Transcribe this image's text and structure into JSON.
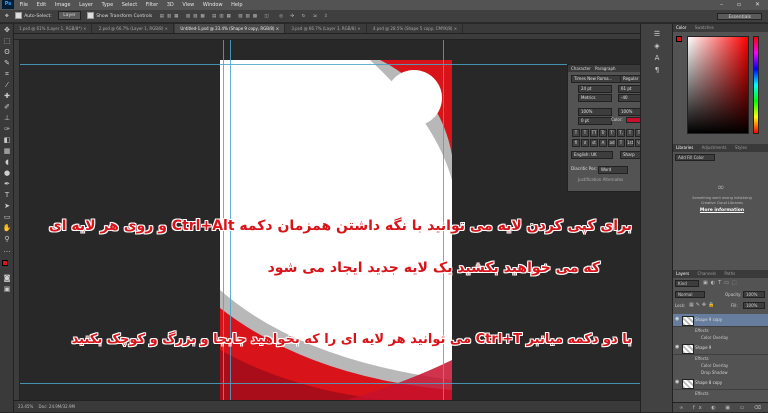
{
  "menubar": {
    "logo": "Ps",
    "items": [
      "File",
      "Edit",
      "Image",
      "Layer",
      "Type",
      "Select",
      "Filter",
      "3D",
      "View",
      "Window",
      "Help"
    ],
    "window_buttons": "– ▫ ✕"
  },
  "optionsbar": {
    "auto_select": "Auto-Select:",
    "auto_select_value": "Layer",
    "show_transform": "Show Transform Controls",
    "workspace": "Essentials"
  },
  "tabs": [
    {
      "label": "1.psd @ 61% (Layer 1, RGB/8*) ×",
      "active": false
    },
    {
      "label": "2.psd @ 66.7% (Layer 1, RGB/8) ×",
      "active": false
    },
    {
      "label": "Untitled-1.psd @ 23.4% (Shape 9 copy, RGB/8) ×",
      "active": true
    },
    {
      "label": "3.psd @ 66.7% (Layer 3, RGB/8) ×",
      "active": false
    },
    {
      "label": "4.psd @ 28.5% (Shape 5 copy, CMYK/8) ×",
      "active": false
    }
  ],
  "status": {
    "zoom": "23.45%",
    "doc": "Doc: 24.9M/32.9M"
  },
  "character": {
    "tabs": [
      "Character",
      "Paragraph"
    ],
    "font_family": "Times New Roma...",
    "font_style": "Regular",
    "size": "24 pt",
    "leading": "61 pt",
    "kerning": "Metrics",
    "tracking": "-40",
    "vscale": "100%",
    "hscale": "100%",
    "baseline": "0 pt",
    "color_label": "Color:",
    "color": "#c8102e",
    "styles": [
      "T",
      "T",
      "TT",
      "Tr",
      "T'",
      "T,",
      "T",
      "T"
    ],
    "features": [
      "fi",
      "σ",
      "st",
      "A",
      "ad",
      "T",
      "1st",
      "½"
    ],
    "language": "English: UK",
    "aa": "Sharp",
    "diacritic_label": "Diacritic Pos:",
    "diacritic": "Word",
    "justification": "Justification Alternates"
  },
  "color_panel": {
    "tabs": [
      "Color",
      "Swatches"
    ]
  },
  "libraries": {
    "tabs": [
      "Libraries",
      "Adjustments",
      "Styles"
    ],
    "add_fill": "Add Fill Color",
    "message": "Something went wrong initializing Creative Cloud Libraries",
    "link": "More information"
  },
  "layers_panel": {
    "tabs": [
      "Layers",
      "Channels",
      "Paths"
    ],
    "kind": "Kind",
    "blend": "Normal",
    "opacity_label": "Opacity:",
    "opacity": "100%",
    "lock_label": "Lock:",
    "fill_label": "Fill:",
    "fill": "100%",
    "layers": [
      {
        "name": "Shape 9 copy",
        "selected": true
      },
      {
        "name": "Effects",
        "sub": true
      },
      {
        "name": "Color Overlay",
        "sub": true
      },
      {
        "name": "Shape 9",
        "selected": false
      },
      {
        "name": "Effects",
        "sub": true
      },
      {
        "name": "Color Overlay",
        "sub": true
      },
      {
        "name": "Drop Shadow",
        "sub": true
      },
      {
        "name": "Shape 8 copy",
        "selected": false
      },
      {
        "name": "Effects",
        "sub": true
      }
    ]
  },
  "overlay": {
    "line1": "برای کپی کردن لایه می توانید با نگه داشتن همزمان دکمه Ctrl+Alt و روی هر لایه ای",
    "line2": "که می خواهید بکشید یک لایه جدید ایجاد می شود",
    "line3": "با دو دکمه میانبر Ctrl+T می توانید هر لایه ای را که بخواهید جابجا و بزرگ و کوچک بکنید"
  },
  "accent_colors": {
    "red": "#d8141a",
    "darkred": "#b00d1c",
    "grey": "#b8b8b8"
  }
}
